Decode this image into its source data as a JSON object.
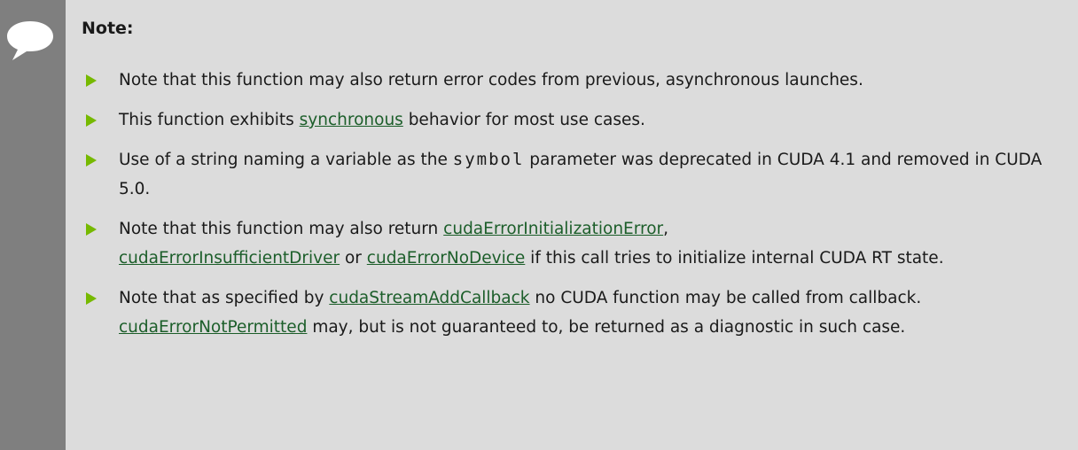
{
  "note": {
    "title": "Note:",
    "icon": "speech-bubble-icon",
    "colors": {
      "background": "#dcdcdc",
      "rail": "#7f7f7f",
      "bullet": "#76b900",
      "link": "#1c5e2a"
    },
    "items": [
      {
        "t1": "Note that this function may also return error codes from previous, asynchronous launches."
      },
      {
        "t1": "This function exhibits ",
        "link1": "synchronous",
        "t2": " behavior for most use cases."
      },
      {
        "t1": "Use of a string naming a variable as the ",
        "code1": "symbol",
        "t2": " parameter was deprecated in CUDA 4.1 and removed in CUDA 5.0."
      },
      {
        "t1": "Note that this function may also return ",
        "link1": "cudaErrorInitializationError",
        "t2": ", ",
        "link2": "cudaErrorInsufficientDriver",
        "t3": " or ",
        "link3": "cudaErrorNoDevice",
        "t4": " if this call tries to initialize internal CUDA RT state."
      },
      {
        "t1": "Note that as specified by ",
        "link1": "cudaStreamAddCallback",
        "t2": " no CUDA function may be called from callback. ",
        "link2": "cudaErrorNotPermitted",
        "t3": " may, but is not guaranteed to, be returned as a diagnostic in such case."
      }
    ]
  }
}
